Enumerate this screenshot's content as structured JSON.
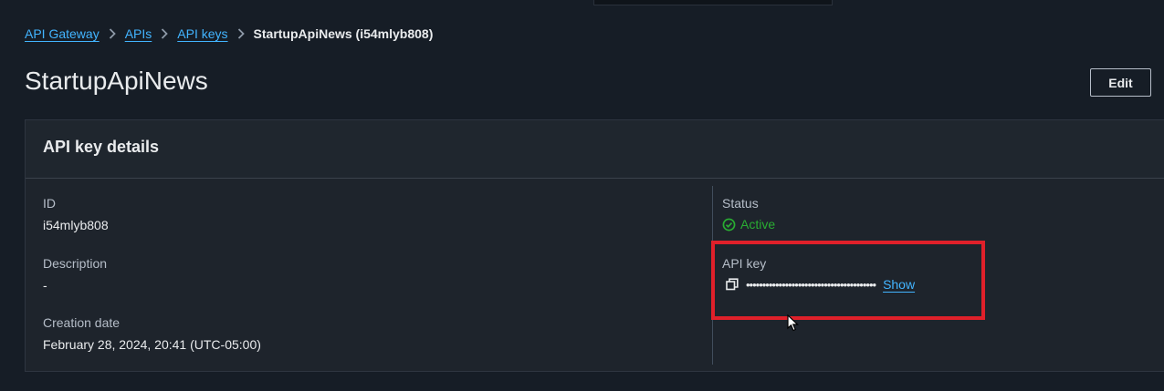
{
  "breadcrumb": {
    "items": [
      "API Gateway",
      "APIs",
      "API keys"
    ],
    "current": "StartupApiNews (i54mlyb808)"
  },
  "page": {
    "title": "StartupApiNews",
    "edit_label": "Edit"
  },
  "panel": {
    "title": "API key details",
    "id_label": "ID",
    "id_value": "i54mlyb808",
    "description_label": "Description",
    "description_value": "-",
    "creation_label": "Creation date",
    "creation_value": "February 28, 2024, 20:41 (UTC-05:00)",
    "status_label": "Status",
    "status_value": "Active",
    "api_key_label": "API key",
    "api_key_masked": "••••••••••••••••••••••••••••••••••••••••",
    "show_label": "Show"
  },
  "icons": {
    "breadcrumb_separator": "chevron-right-icon",
    "status": "check-circle-icon",
    "copy": "copy-icon",
    "cursor": "mouse-pointer-icon"
  },
  "colors": {
    "background": "#161d26",
    "link": "#42b4ff",
    "status_active": "#29ad32",
    "highlight": "#e0202a"
  }
}
